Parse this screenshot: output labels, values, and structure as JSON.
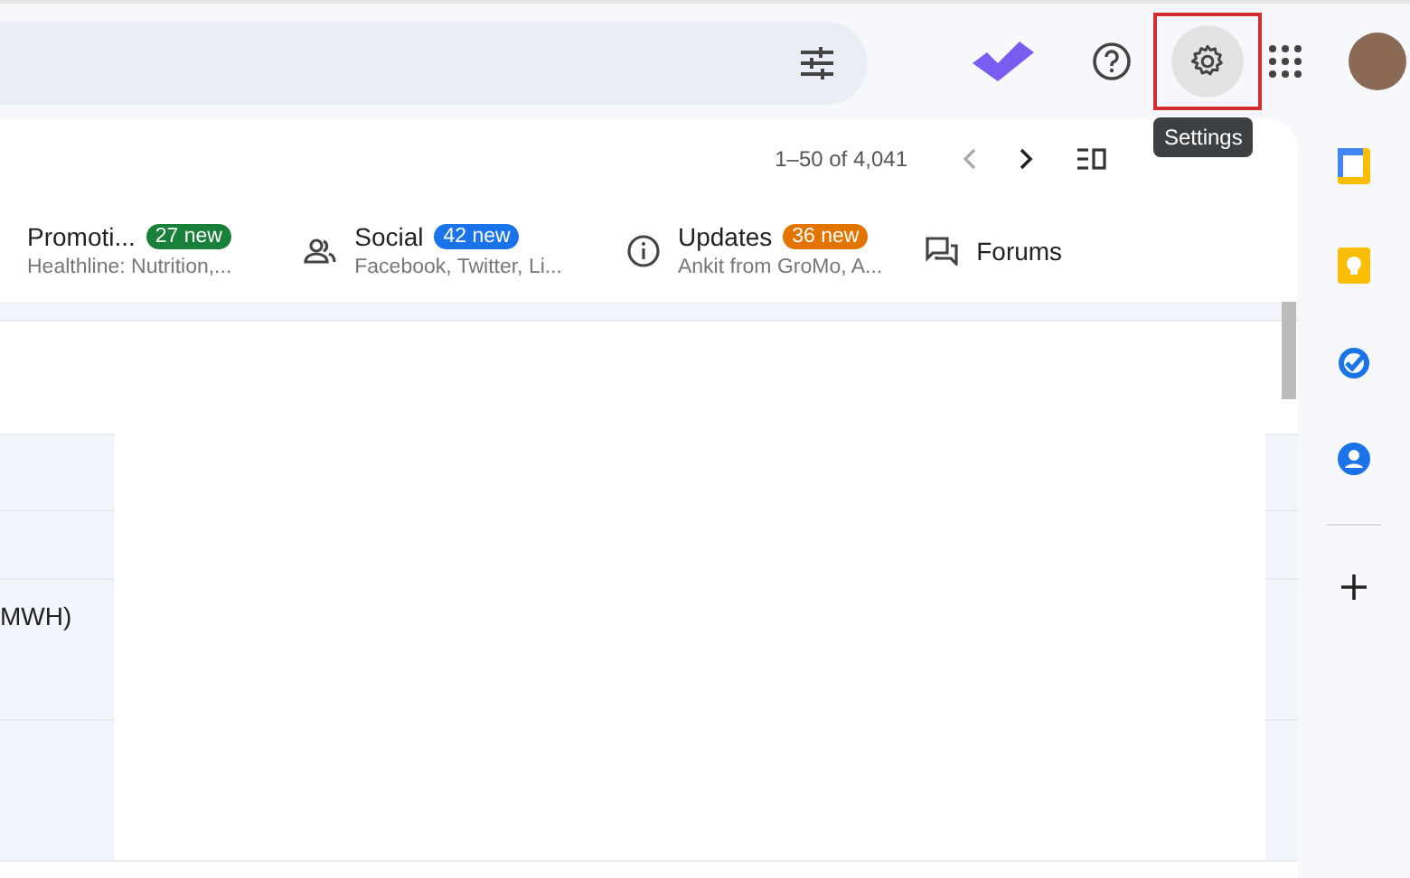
{
  "header": {
    "tooltip": "Settings"
  },
  "toolbar": {
    "pagination": "1–50 of 4,041"
  },
  "tabs": [
    {
      "kind": "none",
      "title": "Promoti...",
      "badge": "27 new",
      "color": "#188038",
      "snippet": "Healthline: Nutrition,..."
    },
    {
      "kind": "people",
      "title": "Social",
      "badge": "42 new",
      "color": "#1a73e8",
      "snippet": "Facebook, Twitter, Li..."
    },
    {
      "kind": "info",
      "title": "Updates",
      "badge": "36 new",
      "color": "#e37400",
      "snippet": "Ankit from GroMo, A..."
    },
    {
      "kind": "forum",
      "title": "Forums"
    }
  ],
  "message_fragment": "MWH)"
}
